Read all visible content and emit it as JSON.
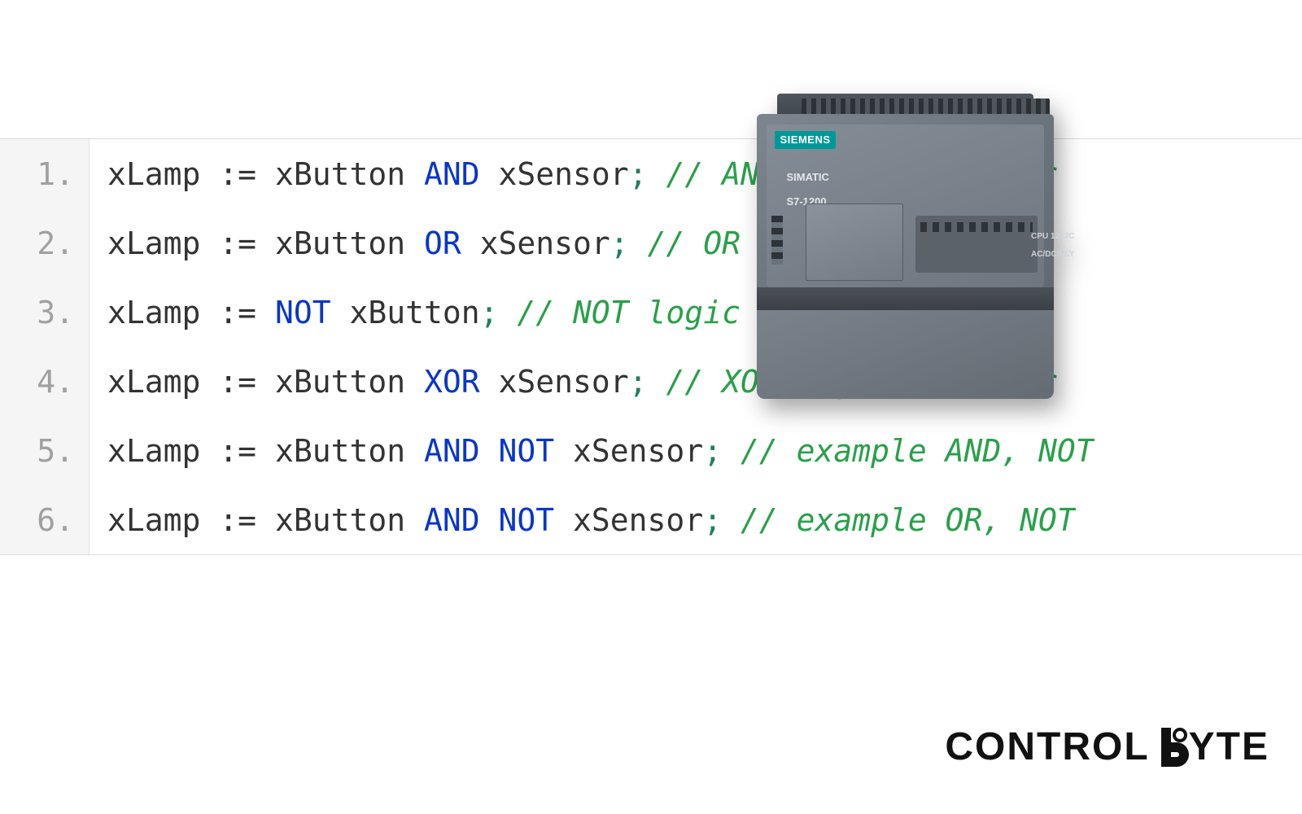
{
  "code": {
    "lines": [
      {
        "n": "1.",
        "tokens": [
          {
            "t": "xLamp",
            "c": "var"
          },
          {
            "t": " ",
            "c": "sp"
          },
          {
            "t": ":=",
            "c": "asgn"
          },
          {
            "t": " ",
            "c": "sp"
          },
          {
            "t": "xButton",
            "c": "var"
          },
          {
            "t": " ",
            "c": "sp"
          },
          {
            "t": "AND",
            "c": "kw"
          },
          {
            "t": " ",
            "c": "sp"
          },
          {
            "t": "xSensor",
            "c": "var"
          },
          {
            "t": ";",
            "c": "punc"
          },
          {
            "t": " ",
            "c": "sp"
          },
          {
            "t": "// AND logic operator",
            "c": "cmt"
          }
        ]
      },
      {
        "n": "2.",
        "tokens": [
          {
            "t": "xLamp",
            "c": "var"
          },
          {
            "t": " ",
            "c": "sp"
          },
          {
            "t": ":=",
            "c": "asgn"
          },
          {
            "t": " ",
            "c": "sp"
          },
          {
            "t": "xButton",
            "c": "var"
          },
          {
            "t": " ",
            "c": "sp"
          },
          {
            "t": "OR",
            "c": "kw"
          },
          {
            "t": " ",
            "c": "sp"
          },
          {
            "t": "xSensor",
            "c": "var"
          },
          {
            "t": ";",
            "c": "punc"
          },
          {
            "t": " ",
            "c": "sp"
          },
          {
            "t": "// OR logic operator",
            "c": "cmt"
          }
        ]
      },
      {
        "n": "3.",
        "tokens": [
          {
            "t": "xLamp",
            "c": "var"
          },
          {
            "t": " ",
            "c": "sp"
          },
          {
            "t": ":=",
            "c": "asgn"
          },
          {
            "t": " ",
            "c": "sp"
          },
          {
            "t": "NOT",
            "c": "kw"
          },
          {
            "t": " ",
            "c": "sp"
          },
          {
            "t": "xButton",
            "c": "var"
          },
          {
            "t": ";",
            "c": "punc"
          },
          {
            "t": " ",
            "c": "sp"
          },
          {
            "t": "// NOT logic operator",
            "c": "cmt"
          }
        ]
      },
      {
        "n": "4.",
        "tokens": [
          {
            "t": "xLamp",
            "c": "var"
          },
          {
            "t": " ",
            "c": "sp"
          },
          {
            "t": ":=",
            "c": "asgn"
          },
          {
            "t": " ",
            "c": "sp"
          },
          {
            "t": "xButton",
            "c": "var"
          },
          {
            "t": " ",
            "c": "sp"
          },
          {
            "t": "XOR",
            "c": "kw"
          },
          {
            "t": " ",
            "c": "sp"
          },
          {
            "t": "xSensor",
            "c": "var"
          },
          {
            "t": ";",
            "c": "punc"
          },
          {
            "t": " ",
            "c": "sp"
          },
          {
            "t": "// XOR logic operator",
            "c": "cmt"
          }
        ]
      },
      {
        "n": "5.",
        "tokens": [
          {
            "t": "xLamp",
            "c": "var"
          },
          {
            "t": " ",
            "c": "sp"
          },
          {
            "t": ":=",
            "c": "asgn"
          },
          {
            "t": " ",
            "c": "sp"
          },
          {
            "t": "xButton",
            "c": "var"
          },
          {
            "t": " ",
            "c": "sp"
          },
          {
            "t": "AND",
            "c": "kw"
          },
          {
            "t": " ",
            "c": "sp"
          },
          {
            "t": "NOT",
            "c": "kw"
          },
          {
            "t": " ",
            "c": "sp"
          },
          {
            "t": "xSensor",
            "c": "var"
          },
          {
            "t": ";",
            "c": "punc"
          },
          {
            "t": " ",
            "c": "sp"
          },
          {
            "t": "// example AND, NOT",
            "c": "cmt"
          }
        ]
      },
      {
        "n": "6.",
        "tokens": [
          {
            "t": "xLamp",
            "c": "var"
          },
          {
            "t": " ",
            "c": "sp"
          },
          {
            "t": ":=",
            "c": "asgn"
          },
          {
            "t": " ",
            "c": "sp"
          },
          {
            "t": "xButton",
            "c": "var"
          },
          {
            "t": " ",
            "c": "sp"
          },
          {
            "t": "AND",
            "c": "kw"
          },
          {
            "t": " ",
            "c": "sp"
          },
          {
            "t": "NOT",
            "c": "kw"
          },
          {
            "t": " ",
            "c": "sp"
          },
          {
            "t": "xSensor",
            "c": "var"
          },
          {
            "t": ";",
            "c": "punc"
          },
          {
            "t": " ",
            "c": "sp"
          },
          {
            "t": "// example OR, NOT",
            "c": "cmt"
          }
        ]
      }
    ]
  },
  "plc": {
    "brand": "SIEMENS",
    "model_line1": "SIMATIC",
    "model_line2": "S7-1200",
    "cpu_line1": "CPU 1212C",
    "cpu_line2": "AC/DC/RLY"
  },
  "footer": {
    "brand_left": "CONTROL",
    "brand_right": "YTE"
  }
}
